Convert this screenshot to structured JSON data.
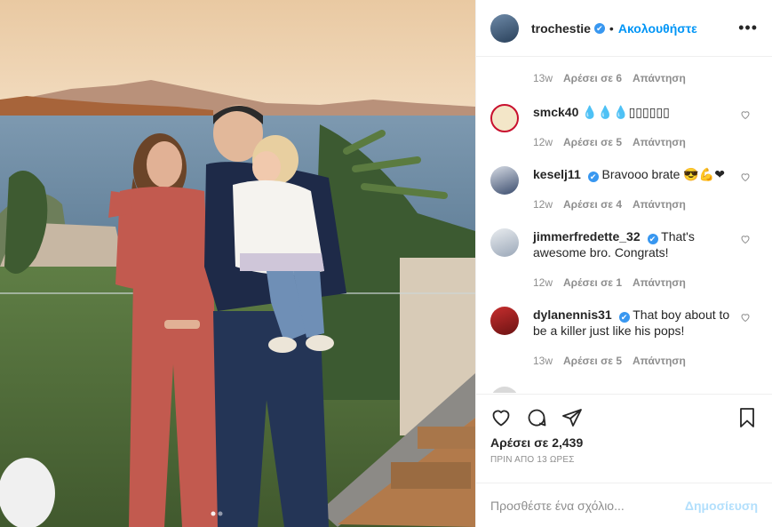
{
  "header": {
    "username": "trochestie",
    "verified": "✔",
    "separator": "•",
    "follow_label": "Ακολουθήστε",
    "more_icon": "more-horizontal-icon"
  },
  "comments": [
    {
      "username": "",
      "text": "",
      "verified": false,
      "time": "13w",
      "likes": "Αρέσει σε 6",
      "reply": "Απάντηση"
    },
    {
      "username": "smck40",
      "text": "💧💧💧▯▯▯▯▯▯",
      "verified": false,
      "time": "12w",
      "likes": "Αρέσει σε 5",
      "reply": "Απάντηση"
    },
    {
      "username": "keselj11",
      "text": "Bravooo brate 😎💪❤",
      "verified": true,
      "time": "12w",
      "likes": "Αρέσει σε 4",
      "reply": "Απάντηση"
    },
    {
      "username": "jimmerfredette_32",
      "text": "That's awesome bro. Congrats!",
      "verified": true,
      "time": "12w",
      "likes": "Αρέσει σε 1",
      "reply": "Απάντηση"
    },
    {
      "username": "dylanennis31",
      "text": "That boy about to be a killer just like his pops!",
      "verified": true,
      "time": "13w",
      "likes": "Αρέσει σε 5",
      "reply": "Απάντηση"
    }
  ],
  "actions": {
    "icons": [
      "heart-icon",
      "comment-icon",
      "share-icon",
      "bookmark-icon"
    ],
    "likes": "Αρέσει σε 2,439",
    "time": "ΠΡΙΝ ΑΠΟ 13 ΩΡΕΣ"
  },
  "add_comment": {
    "placeholder": "Προσθέστε ένα σχόλιο...",
    "post_label": "Δημοσίευση"
  },
  "colors": {
    "accent": "#0095f6",
    "verified": "#3897f0",
    "muted": "#8e8e8e",
    "post_disabled": "#b2dffc"
  }
}
